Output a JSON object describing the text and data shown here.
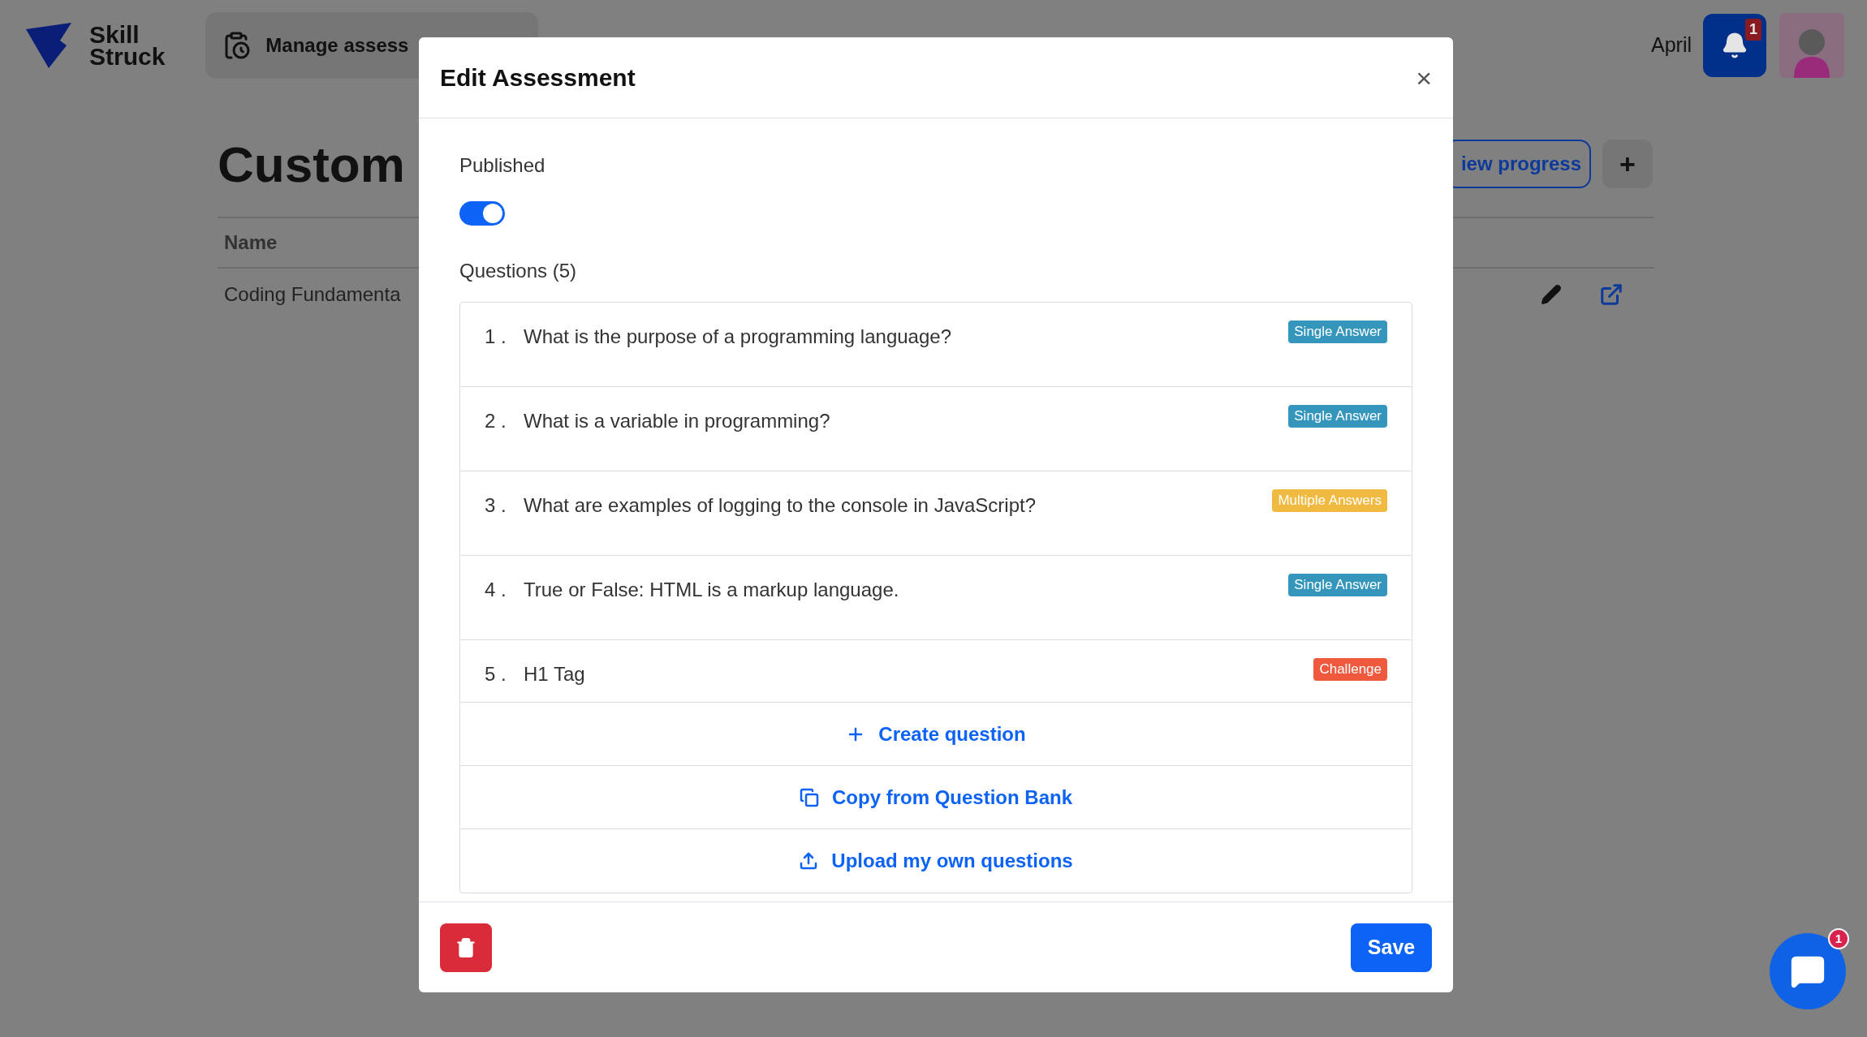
{
  "header": {
    "brand": "Skill Struck",
    "nav_item": "Manage assess",
    "user_name": "April",
    "notification_count": "1"
  },
  "page": {
    "title": "Custom",
    "view_progress": "iew progress",
    "add_button": "+",
    "table": {
      "columns": [
        "Name"
      ],
      "rows": [
        {
          "name": "Coding Fundamenta"
        }
      ]
    }
  },
  "modal": {
    "title": "Edit Assessment",
    "close": "×",
    "published": {
      "label": "Published",
      "on": true
    },
    "questions_label": "Questions (5)",
    "questions": [
      {
        "number": "1 .",
        "text": "What is the purpose of a programming language?",
        "badge": "Single Answer",
        "color": "#3596bb"
      },
      {
        "number": "2 .",
        "text": "What is a variable in programming?",
        "badge": "Single Answer",
        "color": "#3596bb"
      },
      {
        "number": "3 .",
        "text": "What are examples of logging to the console in JavaScript?",
        "badge": "Multiple Answers",
        "color": "#efba3f"
      },
      {
        "number": "4 .",
        "text": "True or False: HTML is a markup language.",
        "badge": "Single Answer",
        "color": "#3596bb"
      },
      {
        "number": "5 .",
        "text": "H1 Tag",
        "badge": "Challenge",
        "color": "#ef5a3f"
      }
    ],
    "actions": [
      {
        "kind": "create",
        "label": "Create question"
      },
      {
        "kind": "copy",
        "label": "Copy from Question Bank"
      },
      {
        "kind": "upload",
        "label": "Upload my own questions"
      }
    ],
    "save": "Save"
  },
  "chat": {
    "count": "1"
  }
}
